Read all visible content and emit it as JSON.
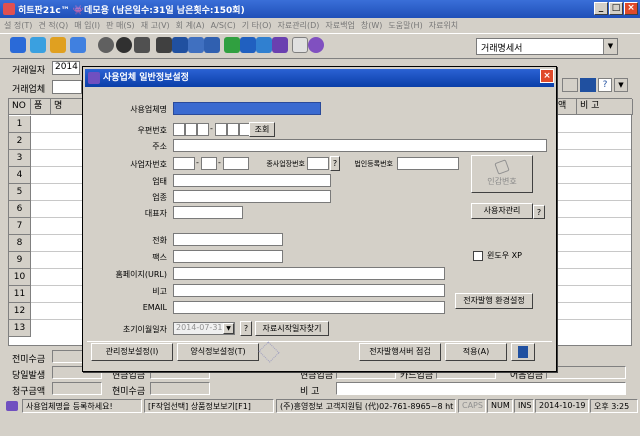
{
  "app": {
    "title": "히트판21c™ 👾데모용 (남은일수:31일 남은횟수:150회)",
    "menu": [
      "설 정(T)",
      "견 적(Q)",
      "매 입(I)",
      "판 매(S)",
      "재 고(V)",
      "회 계(A)",
      "A/S(C)",
      "기 타(O)",
      "자료관리(D)",
      "자료백업",
      "창(W)",
      "도움말(H)",
      "자료위치"
    ],
    "doc_type_combo": "거래명세서"
  },
  "main": {
    "trade_date_label": "거래일자",
    "trade_date_value": "2014",
    "trade_company_label": "거래업체",
    "grid_headers": [
      "NO",
      "품",
      "명",
      "액",
      "비 고"
    ],
    "row_numbers": [
      "1",
      "2",
      "3",
      "4",
      "5",
      "6",
      "7",
      "8",
      "9",
      "10",
      "11",
      "12",
      "13"
    ],
    "bottom_labels": {
      "prev_balance": "전미수금",
      "today_issue": "당일발생",
      "charge_amount": "청구금액",
      "outstanding": "현미수금",
      "remark": "비 고",
      "deposit_amount": "현금입금",
      "card_amount": "카드입금",
      "bank_amount": "어음입금"
    }
  },
  "dialog": {
    "title": "사용업체 일반정보설정",
    "fields": {
      "company_name": "사용업체명",
      "postal_code": "우편번호",
      "address": "주소",
      "biz_number": "사업자번호",
      "sub_biz_number": "종사업장번호",
      "corp_number": "법인등록번호",
      "biz_type": "업태",
      "biz_item": "업종",
      "ceo": "대표자",
      "phone": "전화",
      "fax": "팩스",
      "homepage": "홈페이지(URL)",
      "remark": "비고",
      "email": "EMAIL",
      "carryover_date": "초기이월일자",
      "carryover_date_value": "2014-07-31"
    },
    "buttons": {
      "search": "조회",
      "seal": "인감변호",
      "user_manage": "사용자관리",
      "help": "?",
      "window_xp": "윈도우 XP",
      "e_env": "전자발행 환경설정",
      "data_start": "자료시작일자찾기",
      "manage_info": "관리정보설정(I)",
      "form_info": "양식정보설정(T)",
      "e_server_check": "전자발행서버 점검",
      "apply": "적용(A)"
    }
  },
  "status": {
    "message": "사용업체명을 등록하세요!",
    "hint": "[F작업선택] 상품정보보기[F1]",
    "company": "(주)흥영정보 고객지원팀 (代)02-761-8965~8 ht",
    "caps": "CAPS",
    "num": "NUM",
    "ins": "INS",
    "date": "2014-10-19",
    "time": "오후 3:25"
  }
}
